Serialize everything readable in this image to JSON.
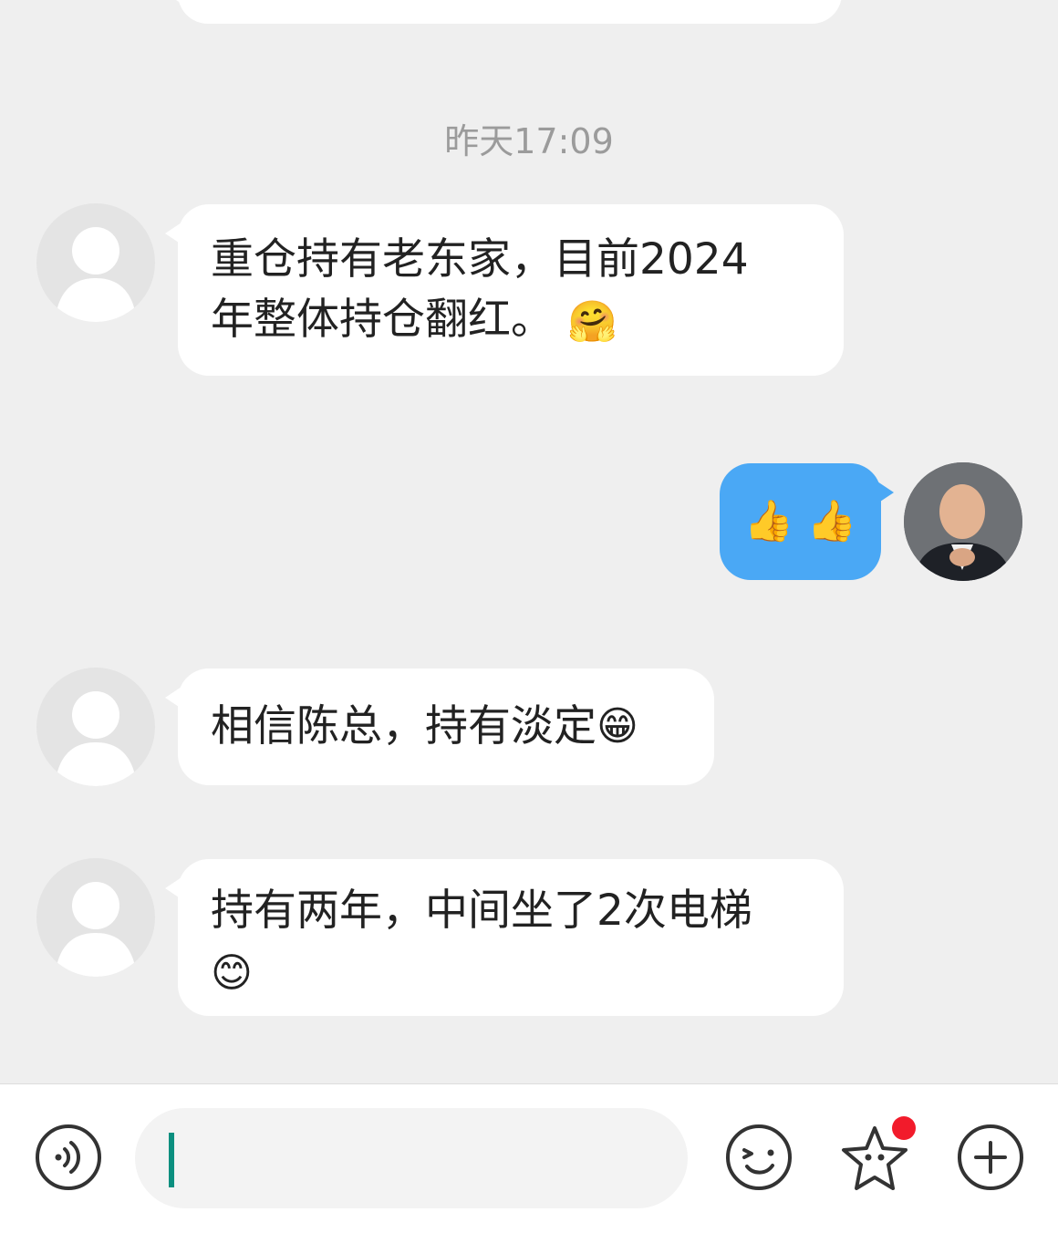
{
  "chat": {
    "timestamp": "昨天17:09",
    "messages": [
      {
        "side": "left",
        "line1": "重仓持有老东家，目前2024",
        "line2": "年整体持仓翻红。",
        "emoji": "🤗"
      },
      {
        "side": "right",
        "emoji": "👍 👍"
      },
      {
        "side": "left",
        "text": "相信陈总，持有淡定",
        "emoji": "😁"
      },
      {
        "side": "left",
        "text": "持有两年，中间坐了2次电梯",
        "emoji": "😊"
      }
    ]
  },
  "input": {
    "value": ""
  },
  "icons": {
    "voice": "voice-icon",
    "emoji": "emoji-icon",
    "sticker": "sticker-icon",
    "add": "plus-icon"
  },
  "colors": {
    "accent": "#4aa8f5",
    "cursor": "#0b8f7f",
    "badge": "#f21b2b"
  }
}
